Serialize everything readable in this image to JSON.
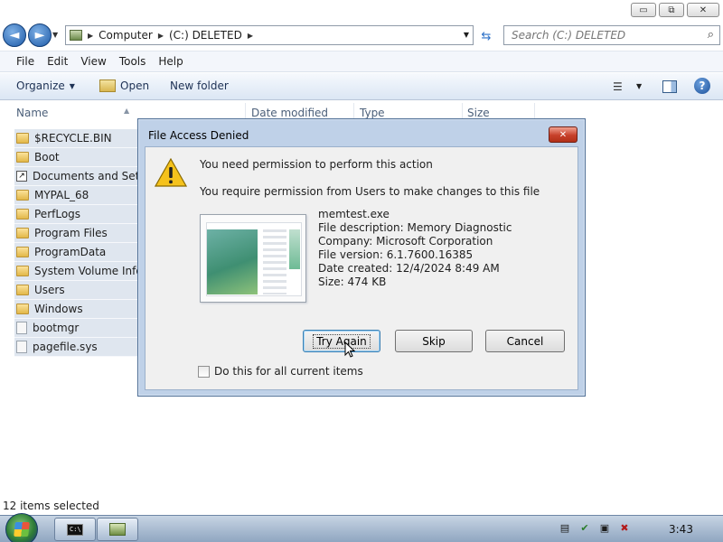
{
  "window": {
    "caption_minimize": "▭",
    "caption_maximize": "⧉",
    "caption_close": "✕"
  },
  "address": {
    "crumbs": [
      "Computer",
      "(C:) DELETED"
    ],
    "search_placeholder": "Search (C:) DELETED"
  },
  "menu": [
    "File",
    "Edit",
    "View",
    "Tools",
    "Help"
  ],
  "toolbar": {
    "organize": "Organize",
    "open": "Open",
    "new_folder": "New folder",
    "help": "?"
  },
  "columns": [
    "Name",
    "Date modified",
    "Type",
    "Size"
  ],
  "files": [
    {
      "name": "$RECYCLE.BIN",
      "icon": "folder-icon"
    },
    {
      "name": "Boot",
      "icon": "folder-icon"
    },
    {
      "name": "Documents and Settings",
      "icon": "shortcut-icon"
    },
    {
      "name": "MYPAL_68",
      "icon": "folder-icon"
    },
    {
      "name": "PerfLogs",
      "icon": "folder-icon"
    },
    {
      "name": "Program Files",
      "icon": "folder-icon"
    },
    {
      "name": "ProgramData",
      "icon": "folder-icon"
    },
    {
      "name": "System Volume Information",
      "icon": "folder-icon"
    },
    {
      "name": "Users",
      "icon": "folder-icon"
    },
    {
      "name": "Windows",
      "icon": "folder-icon"
    },
    {
      "name": "bootmgr",
      "icon": "file-icon"
    },
    {
      "name": "pagefile.sys",
      "icon": "file-icon"
    }
  ],
  "status": {
    "text": "12 items selected"
  },
  "taskbar": {
    "clock": "3:43"
  },
  "dialog": {
    "title": "File Access Denied",
    "close": "✕",
    "message": "You need permission to perform this action",
    "detail": "You require permission from Users to make changes to this file",
    "file_info": [
      "memtest.exe",
      "File description: Memory Diagnostic",
      "Company: Microsoft Corporation",
      "File version: 6.1.7600.16385",
      "Date created: 12/4/2024 8:49 AM",
      "Size: 474 KB"
    ],
    "buttons": {
      "try_again": "Try Again",
      "skip": "Skip",
      "cancel": "Cancel"
    },
    "checkbox_label": "Do this for all current items",
    "checkbox_checked": false
  }
}
